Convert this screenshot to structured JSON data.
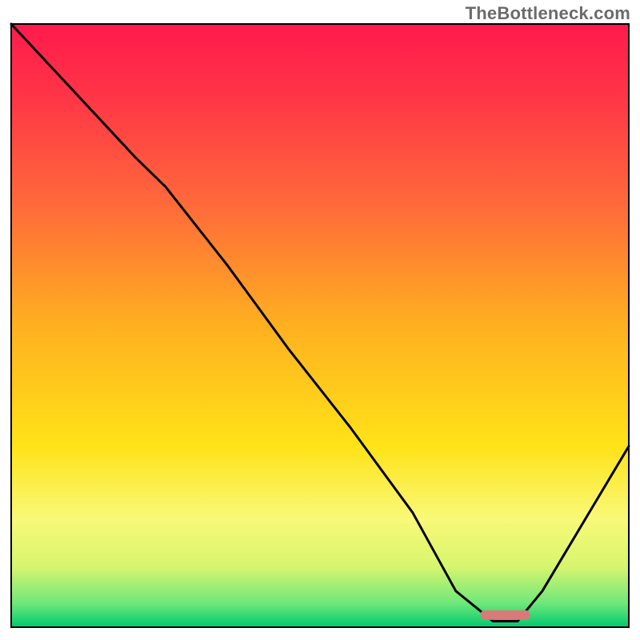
{
  "watermark": "TheBottleneck.com",
  "chart_data": {
    "type": "line",
    "title": "",
    "xlabel": "",
    "ylabel": "",
    "xlim": [
      0,
      100
    ],
    "ylim": [
      0,
      100
    ],
    "grid": false,
    "legend": false,
    "series": [
      {
        "name": "bottleneck-curve",
        "x": [
          0,
          10,
          20,
          25,
          35,
          45,
          55,
          65,
          72,
          78,
          82,
          86,
          100
        ],
        "y": [
          100,
          89,
          78,
          73,
          60,
          46,
          33,
          19,
          6,
          1,
          1,
          6,
          30
        ]
      }
    ],
    "marker": {
      "name": "optimal-range-bar",
      "x_start": 76,
      "x_end": 84,
      "y": 2,
      "color": "#d97a7a"
    },
    "background_gradient": {
      "stops": [
        {
          "offset": 0.0,
          "color": "#ff1a4d"
        },
        {
          "offset": 0.12,
          "color": "#ff3547"
        },
        {
          "offset": 0.3,
          "color": "#ff6a3a"
        },
        {
          "offset": 0.5,
          "color": "#ffb020"
        },
        {
          "offset": 0.7,
          "color": "#ffe318"
        },
        {
          "offset": 0.82,
          "color": "#f9f978"
        },
        {
          "offset": 0.9,
          "color": "#d7f56e"
        },
        {
          "offset": 0.96,
          "color": "#6fe87a"
        },
        {
          "offset": 1.0,
          "color": "#00c96e"
        }
      ]
    }
  }
}
